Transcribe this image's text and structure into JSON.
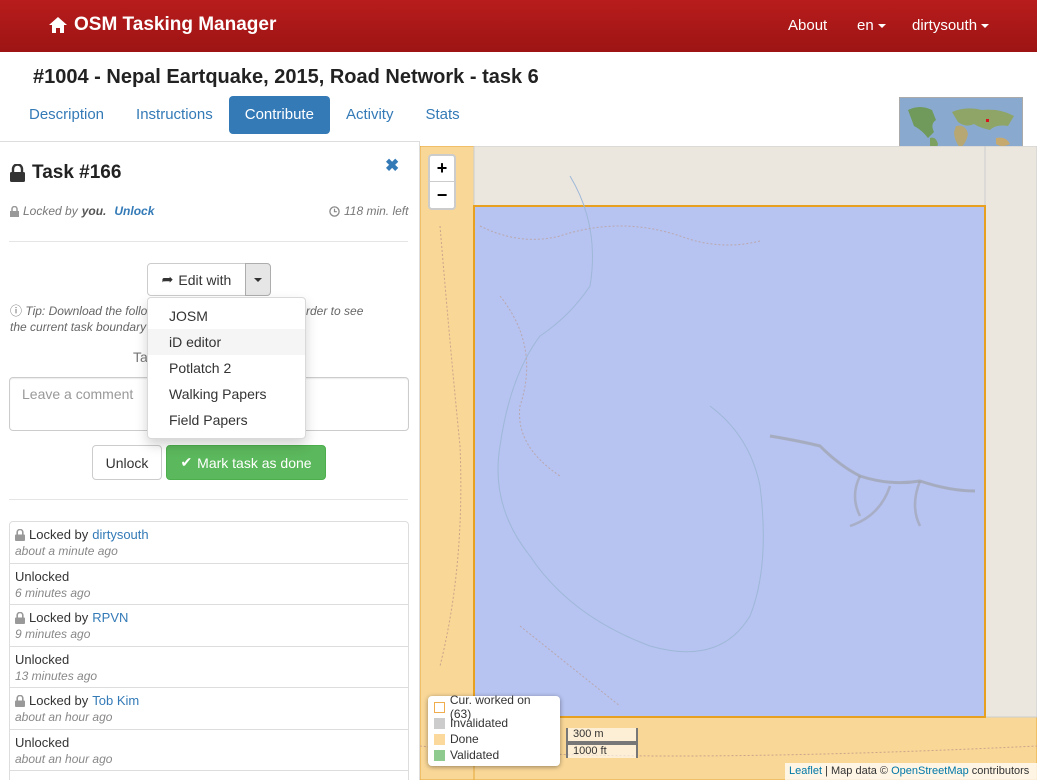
{
  "navbar": {
    "brand": "OSM Tasking Manager",
    "about": "About",
    "lang": "en",
    "user": "dirtysouth",
    "bg_color": "#a51818"
  },
  "page": {
    "title": "#1004 - Nepal Eartquake, 2015, Road Network - task 6"
  },
  "tabs": [
    {
      "label": "Description",
      "active": false
    },
    {
      "label": "Instructions",
      "active": false
    },
    {
      "label": "Contribute",
      "active": true
    },
    {
      "label": "Activity",
      "active": false
    },
    {
      "label": "Stats",
      "active": false
    }
  ],
  "task": {
    "title": "Task #166",
    "locked_by_prefix": "Locked by",
    "locked_by_user": "you.",
    "unlock_link": "Unlock",
    "time_left": "118 min. left",
    "edit_with": "Edit with",
    "tip_line1": "Tip: Download the follo",
    "tip_line1_end": "SM in order to see",
    "tip_line2": "the current task boundary",
    "task_label_fragment": "Ta",
    "comment_placeholder": "Leave a comment",
    "unlock_button": "Unlock",
    "done_button": "Mark task as done"
  },
  "editors": [
    {
      "label": "JOSM"
    },
    {
      "label": "iD editor"
    },
    {
      "label": "Potlatch 2"
    },
    {
      "label": "Walking Papers"
    },
    {
      "label": "Field Papers"
    }
  ],
  "history": [
    {
      "action": "Locked by",
      "user": "dirtysouth",
      "when": "about a minute ago",
      "locked": true
    },
    {
      "action": "Unlocked",
      "user": "",
      "when": "6 minutes ago",
      "locked": false
    },
    {
      "action": "Locked by",
      "user": "RPVN",
      "when": "9 minutes ago",
      "locked": true
    },
    {
      "action": "Unlocked",
      "user": "",
      "when": "13 minutes ago",
      "locked": false
    },
    {
      "action": "Locked by",
      "user": "Tob Kim",
      "when": "about an hour ago",
      "locked": true
    },
    {
      "action": "Unlocked",
      "user": "",
      "when": "about an hour ago",
      "locked": false
    }
  ],
  "map": {
    "zoom_in": "+",
    "zoom_out": "−",
    "legend": [
      {
        "label": "Cur. worked on (63)",
        "color": "#ffffff",
        "border": "#f0ad4e"
      },
      {
        "label": "Invalidated",
        "color": "#cccccc",
        "border": "#cccccc"
      },
      {
        "label": "Done",
        "color": "#fbd89b",
        "border": "#fbd89b"
      },
      {
        "label": "Validated",
        "color": "#8fcb8f",
        "border": "#8fcb8f"
      }
    ],
    "scale_metric": "300 m",
    "scale_imperial": "1000 ft",
    "attrib_leaflet": "Leaflet",
    "attrib_text": " | Map data © ",
    "attrib_osm": "OpenStreetMap",
    "attrib_suffix": " contributors",
    "task_fill": "#b7c3f0",
    "done_fill": "#f9d797"
  }
}
